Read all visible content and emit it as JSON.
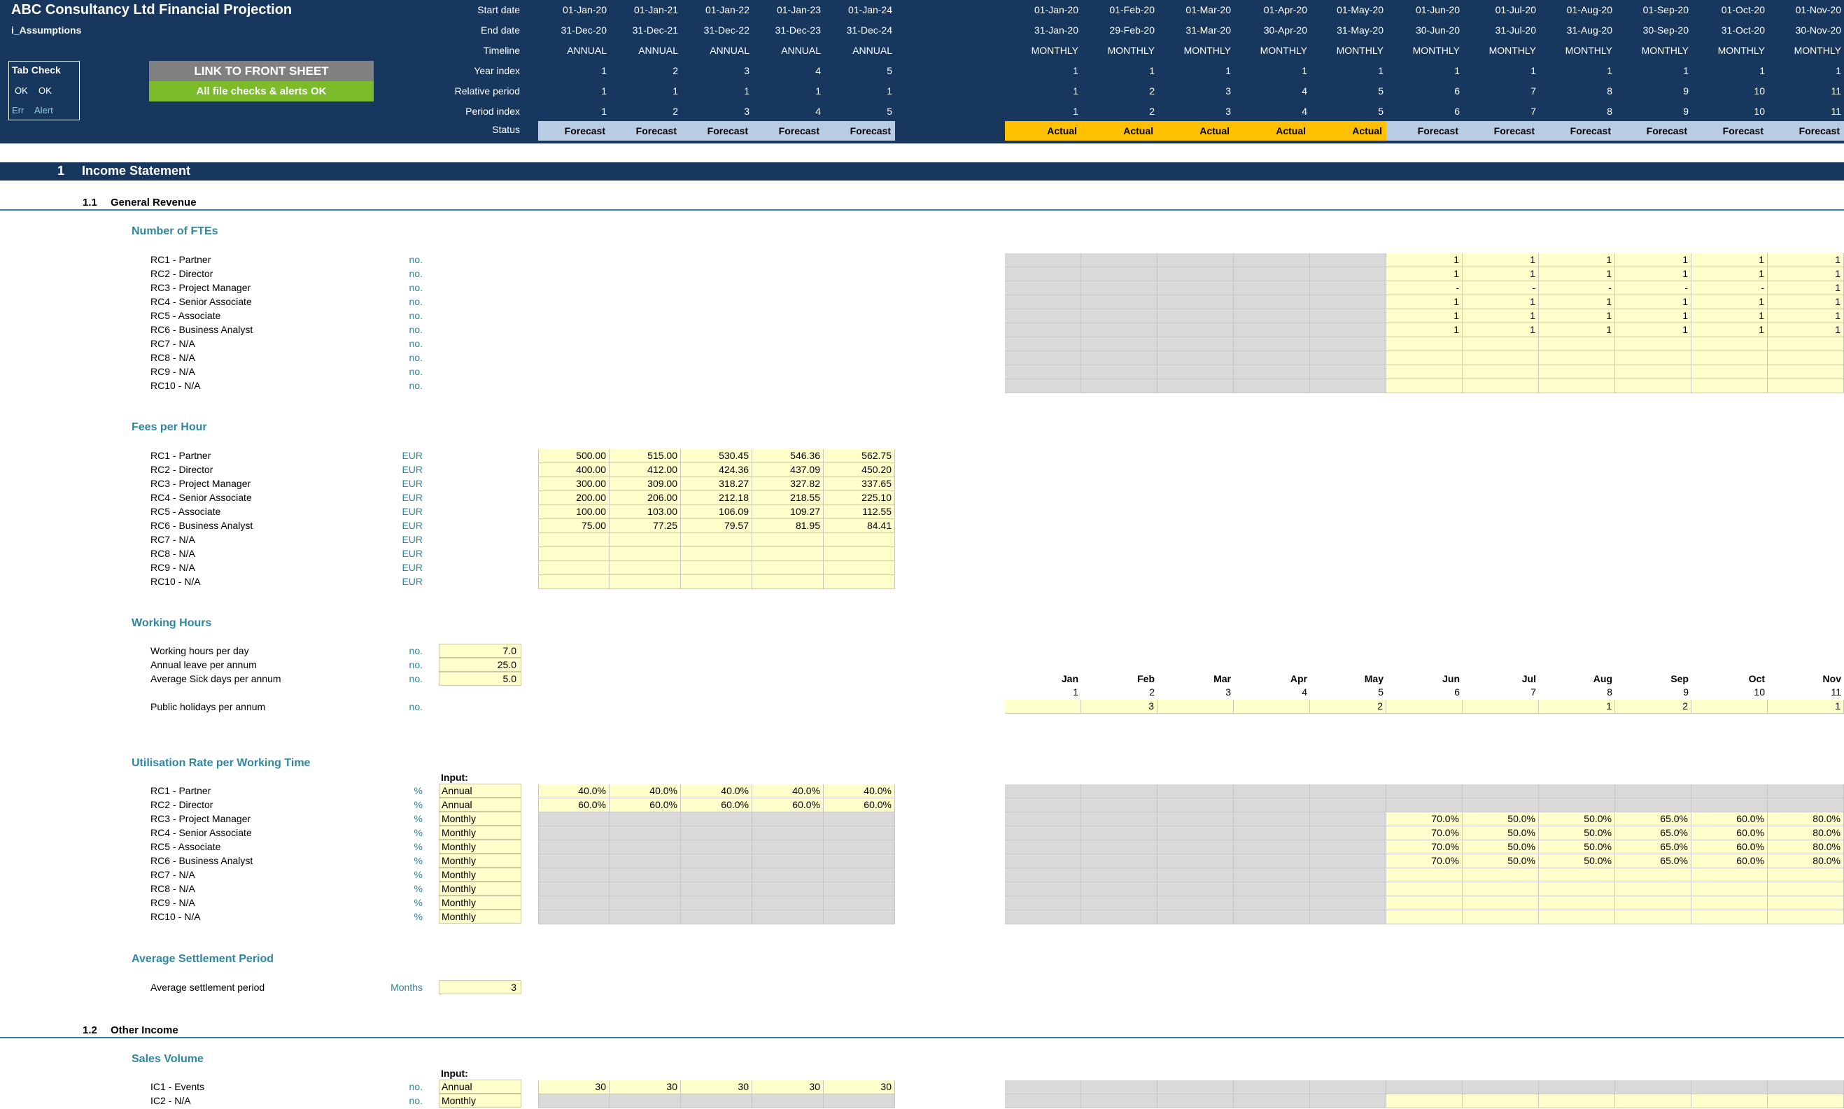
{
  "header": {
    "title": "ABC Consultancy Ltd Financial Projection",
    "sheet": "i_Assumptions",
    "row_labels": [
      "Start date",
      "End date",
      "Timeline",
      "Year index",
      "Relative period",
      "Period index",
      "Status"
    ],
    "link_button": "LINK TO FRONT SHEET",
    "checks_banner": "All file checks & alerts OK",
    "tab_check": {
      "title": "Tab Check",
      "ok1": "OK",
      "ok2": "OK",
      "err": "Err",
      "alert": "Alert"
    }
  },
  "annual_cols": [
    {
      "start": "01-Jan-20",
      "end": "31-Dec-20",
      "timeline": "ANNUAL",
      "year": "1",
      "rel": "1",
      "period": "1",
      "status": "Forecast"
    },
    {
      "start": "01-Jan-21",
      "end": "31-Dec-21",
      "timeline": "ANNUAL",
      "year": "2",
      "rel": "1",
      "period": "2",
      "status": "Forecast"
    },
    {
      "start": "01-Jan-22",
      "end": "31-Dec-22",
      "timeline": "ANNUAL",
      "year": "3",
      "rel": "1",
      "period": "3",
      "status": "Forecast"
    },
    {
      "start": "01-Jan-23",
      "end": "31-Dec-23",
      "timeline": "ANNUAL",
      "year": "4",
      "rel": "1",
      "period": "4",
      "status": "Forecast"
    },
    {
      "start": "01-Jan-24",
      "end": "31-Dec-24",
      "timeline": "ANNUAL",
      "year": "5",
      "rel": "1",
      "period": "5",
      "status": "Forecast"
    }
  ],
  "monthly_cols": [
    {
      "start": "01-Jan-20",
      "end": "31-Jan-20",
      "timeline": "MONTHLY",
      "year": "1",
      "rel": "1",
      "period": "1",
      "status": "Actual",
      "mon": "Jan",
      "num": "1"
    },
    {
      "start": "01-Feb-20",
      "end": "29-Feb-20",
      "timeline": "MONTHLY",
      "year": "1",
      "rel": "2",
      "period": "2",
      "status": "Actual",
      "mon": "Feb",
      "num": "2"
    },
    {
      "start": "01-Mar-20",
      "end": "31-Mar-20",
      "timeline": "MONTHLY",
      "year": "1",
      "rel": "3",
      "period": "3",
      "status": "Actual",
      "mon": "Mar",
      "num": "3"
    },
    {
      "start": "01-Apr-20",
      "end": "30-Apr-20",
      "timeline": "MONTHLY",
      "year": "1",
      "rel": "4",
      "period": "4",
      "status": "Actual",
      "mon": "Apr",
      "num": "4"
    },
    {
      "start": "01-May-20",
      "end": "31-May-20",
      "timeline": "MONTHLY",
      "year": "1",
      "rel": "5",
      "period": "5",
      "status": "Actual",
      "mon": "May",
      "num": "5"
    },
    {
      "start": "01-Jun-20",
      "end": "30-Jun-20",
      "timeline": "MONTHLY",
      "year": "1",
      "rel": "6",
      "period": "6",
      "status": "Forecast",
      "mon": "Jun",
      "num": "6"
    },
    {
      "start": "01-Jul-20",
      "end": "31-Jul-20",
      "timeline": "MONTHLY",
      "year": "1",
      "rel": "7",
      "period": "7",
      "status": "Forecast",
      "mon": "Jul",
      "num": "7"
    },
    {
      "start": "01-Aug-20",
      "end": "31-Aug-20",
      "timeline": "MONTHLY",
      "year": "1",
      "rel": "8",
      "period": "8",
      "status": "Forecast",
      "mon": "Aug",
      "num": "8"
    },
    {
      "start": "01-Sep-20",
      "end": "30-Sep-20",
      "timeline": "MONTHLY",
      "year": "1",
      "rel": "9",
      "period": "9",
      "status": "Forecast",
      "mon": "Sep",
      "num": "9"
    },
    {
      "start": "01-Oct-20",
      "end": "31-Oct-20",
      "timeline": "MONTHLY",
      "year": "1",
      "rel": "10",
      "period": "10",
      "status": "Forecast",
      "mon": "Oct",
      "num": "10"
    },
    {
      "start": "01-Nov-20",
      "end": "30-Nov-20",
      "timeline": "MONTHLY",
      "year": "1",
      "rel": "11",
      "period": "11",
      "status": "Forecast",
      "mon": "Nov",
      "num": "11"
    }
  ],
  "sections": {
    "s1_num": "1",
    "s1_title": "Income Statement",
    "s11_num": "1.1",
    "s11_title": "General Revenue",
    "s12_num": "1.2",
    "s12_title": "Other Income"
  },
  "ftes": {
    "title": "Number of FTEs",
    "unit": "no.",
    "rows": [
      {
        "label": "RC1 - Partner",
        "m": [
          "1",
          "1",
          "1",
          "1",
          "1",
          "1"
        ]
      },
      {
        "label": "RC2 - Director",
        "m": [
          "1",
          "1",
          "1",
          "1",
          "1",
          "1"
        ]
      },
      {
        "label": "RC3 - Project Manager",
        "m": [
          "-",
          "-",
          "-",
          "-",
          "-",
          "1"
        ]
      },
      {
        "label": "RC4 - Senior Associate",
        "m": [
          "1",
          "1",
          "1",
          "1",
          "1",
          "1"
        ]
      },
      {
        "label": "RC5 - Associate",
        "m": [
          "1",
          "1",
          "1",
          "1",
          "1",
          "1"
        ]
      },
      {
        "label": "RC6 - Business Analyst",
        "m": [
          "1",
          "1",
          "1",
          "1",
          "1",
          "1"
        ]
      },
      {
        "label": "RC7 - N/A",
        "m": [
          "",
          "",
          "",
          "",
          "",
          ""
        ]
      },
      {
        "label": "RC8 - N/A",
        "m": [
          "",
          "",
          "",
          "",
          "",
          ""
        ]
      },
      {
        "label": "RC9 - N/A",
        "m": [
          "",
          "",
          "",
          "",
          "",
          ""
        ]
      },
      {
        "label": "RC10 - N/A",
        "m": [
          "",
          "",
          "",
          "",
          "",
          ""
        ]
      }
    ]
  },
  "fees": {
    "title": "Fees per Hour",
    "unit": "EUR",
    "rows": [
      {
        "label": "RC1 - Partner",
        "a": [
          "500.00",
          "515.00",
          "530.45",
          "546.36",
          "562.75"
        ]
      },
      {
        "label": "RC2 - Director",
        "a": [
          "400.00",
          "412.00",
          "424.36",
          "437.09",
          "450.20"
        ]
      },
      {
        "label": "RC3 - Project Manager",
        "a": [
          "300.00",
          "309.00",
          "318.27",
          "327.82",
          "337.65"
        ]
      },
      {
        "label": "RC4 - Senior Associate",
        "a": [
          "200.00",
          "206.00",
          "212.18",
          "218.55",
          "225.10"
        ]
      },
      {
        "label": "RC5 - Associate",
        "a": [
          "100.00",
          "103.00",
          "106.09",
          "109.27",
          "112.55"
        ]
      },
      {
        "label": "RC6 - Business Analyst",
        "a": [
          "75.00",
          "77.25",
          "79.57",
          "81.95",
          "84.41"
        ]
      },
      {
        "label": "RC7 - N/A",
        "a": [
          "",
          "",
          "",
          "",
          ""
        ]
      },
      {
        "label": "RC8 - N/A",
        "a": [
          "",
          "",
          "",
          "",
          ""
        ]
      },
      {
        "label": "RC9 - N/A",
        "a": [
          "",
          "",
          "",
          "",
          ""
        ]
      },
      {
        "label": "RC10 - N/A",
        "a": [
          "",
          "",
          "",
          "",
          ""
        ]
      }
    ]
  },
  "working": {
    "title": "Working Hours",
    "rows": [
      {
        "label": "Working hours per day",
        "unit": "no.",
        "value": "7.0"
      },
      {
        "label": "Annual leave per annum",
        "unit": "no.",
        "value": "25.0"
      },
      {
        "label": "Average Sick days per annum",
        "unit": "no.",
        "value": "5.0"
      }
    ],
    "public_label": "Public holidays per annum",
    "public_unit": "no.",
    "public_m": [
      "",
      "3",
      "",
      "",
      "2",
      "",
      "",
      "1",
      "2",
      "",
      "1"
    ]
  },
  "util": {
    "title": "Utilisation Rate per Working Time",
    "input_label": "Input:",
    "unit": "%",
    "rows": [
      {
        "label": "RC1 - Partner",
        "input": "Annual",
        "a": [
          "40.0%",
          "40.0%",
          "40.0%",
          "40.0%",
          "40.0%"
        ],
        "m": [
          "",
          "",
          "",
          "",
          "",
          ""
        ]
      },
      {
        "label": "RC2 - Director",
        "input": "Annual",
        "a": [
          "60.0%",
          "60.0%",
          "60.0%",
          "60.0%",
          "60.0%"
        ],
        "m": [
          "",
          "",
          "",
          "",
          "",
          ""
        ]
      },
      {
        "label": "RC3 - Project Manager",
        "input": "Monthly",
        "a": [
          "",
          "",
          "",
          "",
          ""
        ],
        "m": [
          "70.0%",
          "50.0%",
          "50.0%",
          "65.0%",
          "60.0%",
          "80.0%"
        ]
      },
      {
        "label": "RC4 - Senior Associate",
        "input": "Monthly",
        "a": [
          "",
          "",
          "",
          "",
          ""
        ],
        "m": [
          "70.0%",
          "50.0%",
          "50.0%",
          "65.0%",
          "60.0%",
          "80.0%"
        ]
      },
      {
        "label": "RC5 - Associate",
        "input": "Monthly",
        "a": [
          "",
          "",
          "",
          "",
          ""
        ],
        "m": [
          "70.0%",
          "50.0%",
          "50.0%",
          "65.0%",
          "60.0%",
          "80.0%"
        ]
      },
      {
        "label": "RC6 - Business Analyst",
        "input": "Monthly",
        "a": [
          "",
          "",
          "",
          "",
          ""
        ],
        "m": [
          "70.0%",
          "50.0%",
          "50.0%",
          "65.0%",
          "60.0%",
          "80.0%"
        ]
      },
      {
        "label": "RC7 - N/A",
        "input": "Monthly",
        "a": [
          "",
          "",
          "",
          "",
          ""
        ],
        "m": [
          "",
          "",
          "",
          "",
          "",
          ""
        ]
      },
      {
        "label": "RC8 - N/A",
        "input": "Monthly",
        "a": [
          "",
          "",
          "",
          "",
          ""
        ],
        "m": [
          "",
          "",
          "",
          "",
          "",
          ""
        ]
      },
      {
        "label": "RC9 - N/A",
        "input": "Monthly",
        "a": [
          "",
          "",
          "",
          "",
          ""
        ],
        "m": [
          "",
          "",
          "",
          "",
          "",
          ""
        ]
      },
      {
        "label": "RC10 - N/A",
        "input": "Monthly",
        "a": [
          "",
          "",
          "",
          "",
          ""
        ],
        "m": [
          "",
          "",
          "",
          "",
          "",
          ""
        ]
      }
    ]
  },
  "settlement": {
    "title": "Average Settlement Period",
    "label": "Average settlement period",
    "unit": "Months",
    "value": "3"
  },
  "sales": {
    "title": "Sales Volume",
    "input_label": "Input:",
    "unit": "no.",
    "rows": [
      {
        "label": "IC1 - Events",
        "input": "Annual",
        "a": [
          "30",
          "30",
          "30",
          "30",
          "30"
        ]
      },
      {
        "label": "IC2 - N/A",
        "input": "Monthly",
        "a": [
          "",
          "",
          "",
          "",
          ""
        ]
      }
    ]
  }
}
